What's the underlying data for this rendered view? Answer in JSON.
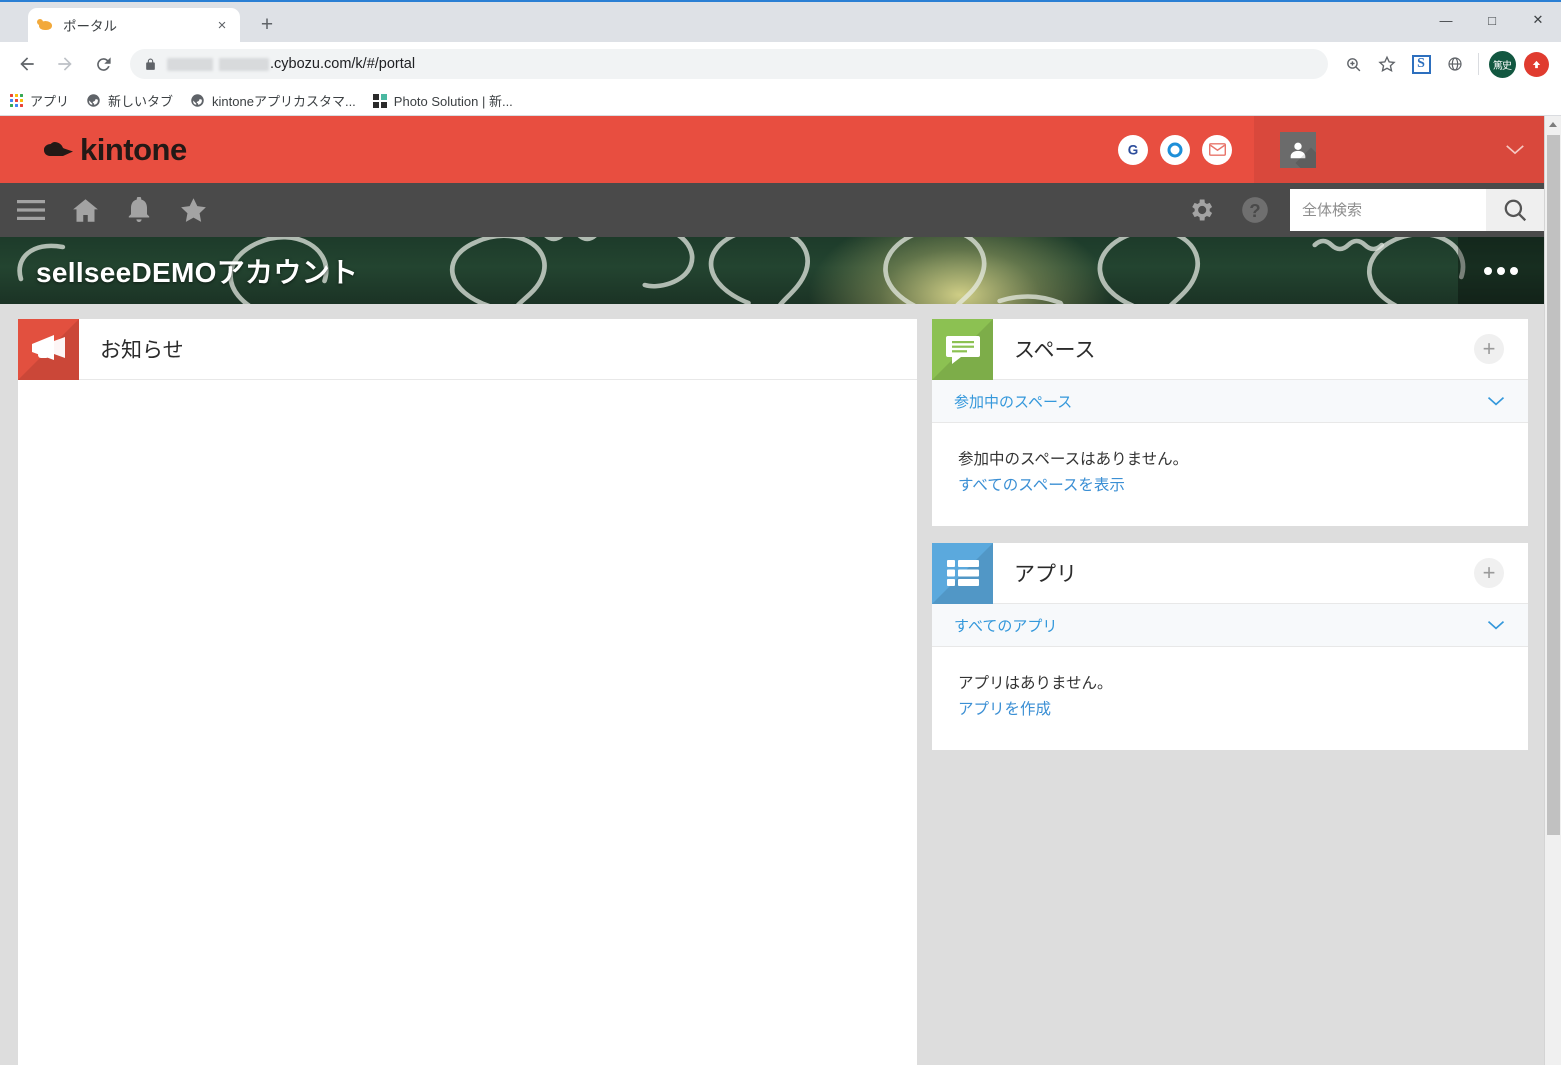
{
  "browser": {
    "tab": {
      "title": "ポータル",
      "favicon": "kintone-cloud-icon",
      "close_label": "×"
    },
    "new_tab_label": "+",
    "window_controls": {
      "minimize": "—",
      "maximize": "□",
      "close": "✕"
    },
    "nav": {
      "back": "←",
      "forward": "→",
      "reload": "⟳"
    },
    "omnibox": {
      "secure_icon": "lock-icon",
      "url_visible": ".cybozu.com/k/#/portal",
      "url_redacted": true
    },
    "toolbar_icons": [
      "zoom-icon",
      "bookmark-star-icon",
      "s-extension-icon",
      "globe-extension-icon"
    ],
    "profile": {
      "initials": "篤史"
    },
    "extension_badge": "↑",
    "bookmarks": [
      {
        "label": "アプリ",
        "icon": "apps-grid-icon"
      },
      {
        "label": "新しいタブ",
        "icon": "globe-icon"
      },
      {
        "label": "kintoneアプリカスタマ...",
        "icon": "globe-icon"
      },
      {
        "label": "Photo Solution | 新...",
        "icon": "squares-icon"
      }
    ]
  },
  "kintone": {
    "colors": {
      "header_red": "#e84e40",
      "header_red_dark": "#d9483c",
      "nav_dark": "#4a4a4a",
      "banner_green": "#234430",
      "link_blue": "#3b8fd4",
      "page_bg": "#dddddd",
      "announce_icon_bg": "#e2503f",
      "space_icon_bg": "#8cc152",
      "app_icon_bg": "#5ba9dd"
    },
    "logo": {
      "text": "kintone",
      "icon": "kintone-cloud-logo"
    },
    "header_apps": [
      {
        "name": "garoon-icon",
        "glyph": "G"
      },
      {
        "name": "office-icon",
        "glyph": "O"
      },
      {
        "name": "mail-icon",
        "glyph": "✉"
      }
    ],
    "user_menu": {
      "avatar": "user-avatar",
      "chevron": "chevron-down-icon"
    },
    "nav_icons": [
      {
        "name": "hamburger-menu-icon"
      },
      {
        "name": "home-icon"
      },
      {
        "name": "notifications-bell-icon"
      },
      {
        "name": "favorites-star-icon"
      }
    ],
    "nav_right_icons": [
      {
        "name": "settings-gear-icon"
      },
      {
        "name": "help-icon",
        "glyph": "?"
      }
    ],
    "search": {
      "placeholder": "全体検索",
      "value": "",
      "button_icon": "search-icon"
    },
    "banner": {
      "title": "sellseeDEMOアカウント",
      "menu_icon": "more-options-icon"
    },
    "portlets": {
      "announcements": {
        "title": "お知らせ",
        "icon": "megaphone-icon",
        "body_text": ""
      },
      "spaces": {
        "title": "スペース",
        "icon": "speech-bubble-icon",
        "add_label": "+",
        "section_label": "参加中のスペース",
        "section_chevron": "chevron-down-icon",
        "empty_message": "参加中のスペースはありません。",
        "action_link": "すべてのスペースを表示"
      },
      "apps": {
        "title": "アプリ",
        "icon": "app-list-icon",
        "add_label": "+",
        "section_label": "すべてのアプリ",
        "section_chevron": "chevron-down-icon",
        "empty_message": "アプリはありません。",
        "action_link": "アプリを作成"
      }
    }
  }
}
